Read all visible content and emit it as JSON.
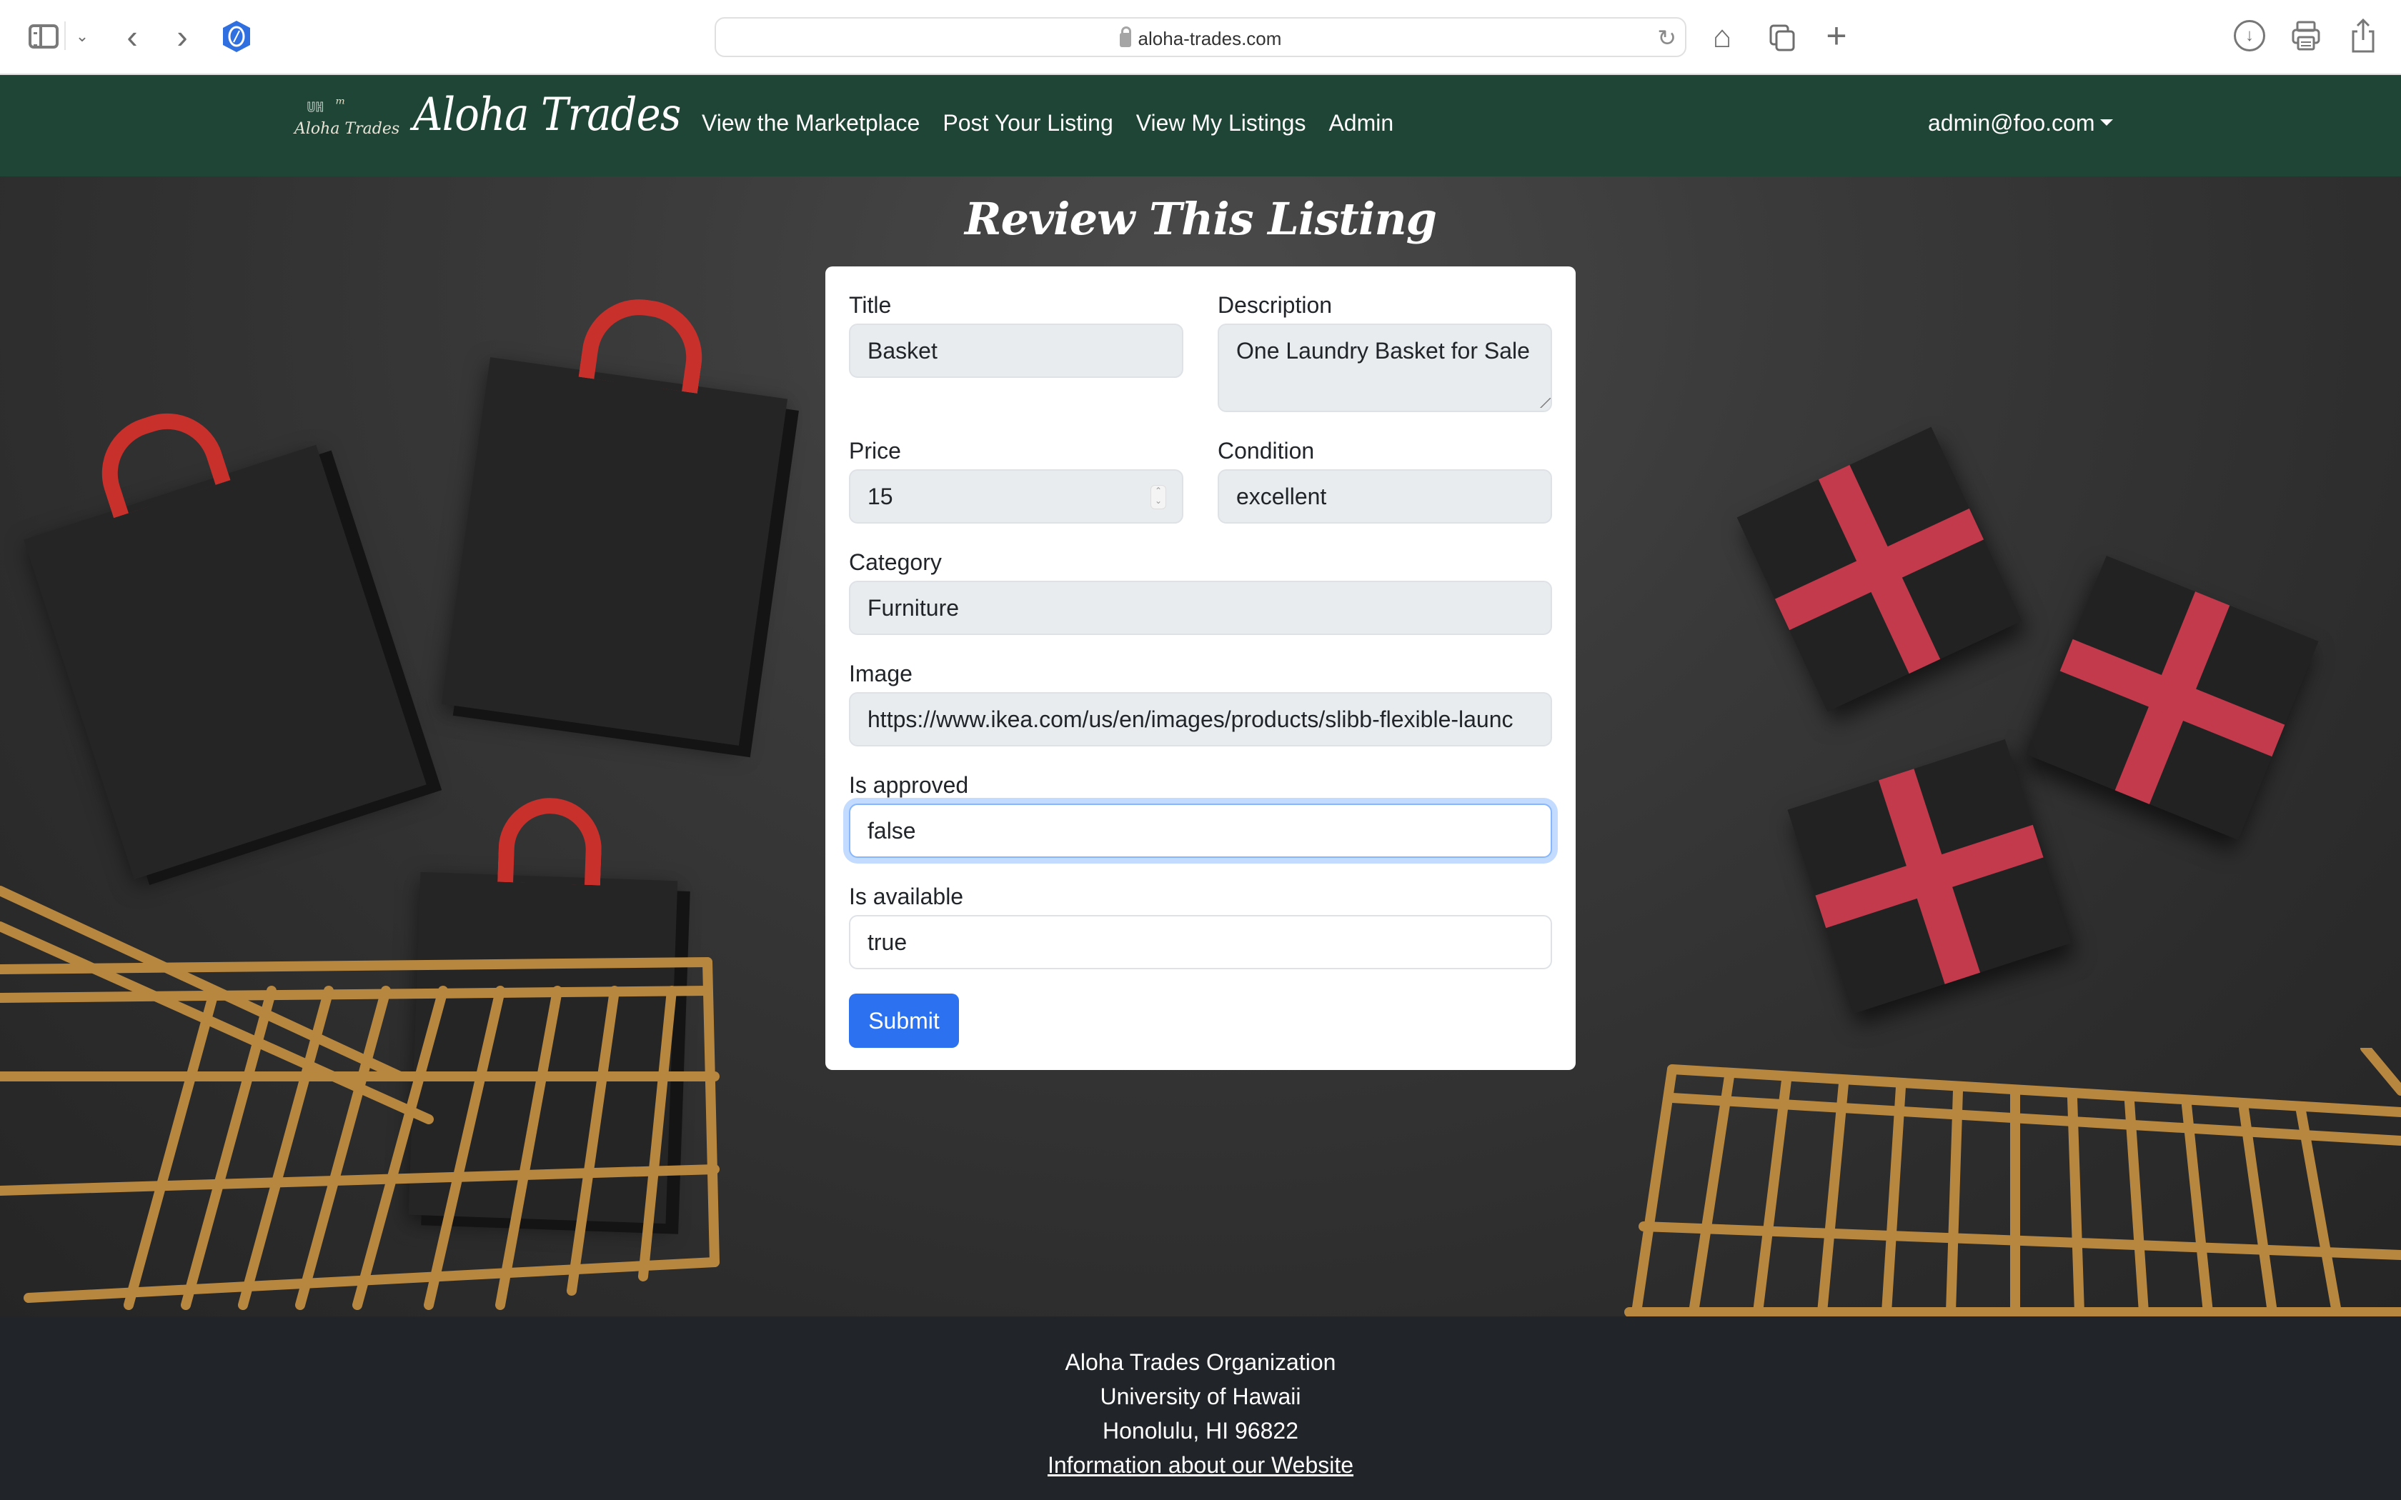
{
  "browser": {
    "url": "aloha-trades.com",
    "icons": [
      "sidebar-icon",
      "chevron-down-icon",
      "back-icon",
      "forward-icon",
      "privacy-shield-icon",
      "lock-icon",
      "reload-icon",
      "home-icon",
      "tabs-overview-icon",
      "new-tab-icon",
      "downloads-icon",
      "print-icon",
      "share-icon"
    ]
  },
  "navbar": {
    "logo_text": "Aloha Trades",
    "logo_mark": "UH",
    "brand": "Aloha Trades",
    "links": [
      {
        "label": "View the Marketplace"
      },
      {
        "label": "Post Your Listing"
      },
      {
        "label": "View My Listings"
      },
      {
        "label": "Admin"
      }
    ],
    "user": "admin@foo.com"
  },
  "page": {
    "title": "Review This Listing"
  },
  "form": {
    "title": {
      "label": "Title",
      "value": "Basket"
    },
    "description": {
      "label": "Description",
      "value": "One Laundry Basket for Sale"
    },
    "price": {
      "label": "Price",
      "value": "15"
    },
    "condition": {
      "label": "Condition",
      "value": "excellent"
    },
    "category": {
      "label": "Category",
      "value": "Furniture"
    },
    "image": {
      "label": "Image",
      "value": "https://www.ikea.com/us/en/images/products/slibb-flexible-launc"
    },
    "is_approved": {
      "label": "Is approved",
      "value": "false"
    },
    "is_available": {
      "label": "Is available",
      "value": "true"
    },
    "submit_label": "Submit"
  },
  "footer": {
    "line1": "Aloha Trades Organization",
    "line2": "University of Hawaii",
    "line3": "Honolulu, HI 96822",
    "link": "Information about our Website"
  },
  "colors": {
    "navbar": "#1e4535",
    "footer": "#212529",
    "primary": "#2b71f0",
    "input_disabled": "#e9ecef",
    "focus_ring": "#86b7fe"
  }
}
